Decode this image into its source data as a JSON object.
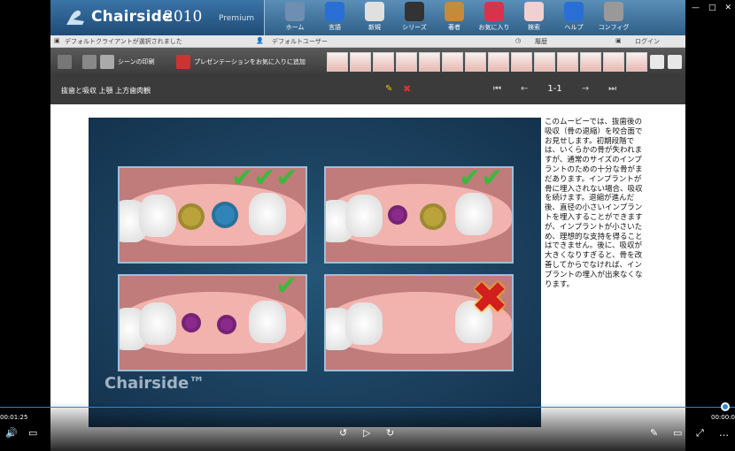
{
  "app": {
    "name": "Chairside",
    "year": "2010",
    "edition": "Premium"
  },
  "nav": [
    {
      "label": "ホーム",
      "icon": "chair-icon",
      "color": "#6f8fb0"
    },
    {
      "label": "言語",
      "icon": "language-icon",
      "color": "#2a6fd6"
    },
    {
      "label": "新規",
      "icon": "new-icon",
      "color": "#e0e0e0"
    },
    {
      "label": "シリーズ",
      "icon": "clapper-icon",
      "color": "#333333"
    },
    {
      "label": "著者",
      "icon": "author-icon",
      "color": "#c58a3a"
    },
    {
      "label": "お気に入り",
      "icon": "favorites-icon",
      "color": "#d8334c"
    },
    {
      "label": "検索",
      "icon": "search-teeth-icon",
      "color": "#f0d0d0"
    },
    {
      "label": "ヘルプ",
      "icon": "help-icon",
      "color": "#2a6fd6"
    },
    {
      "label": "コンフィグ",
      "icon": "config-icon",
      "color": "#999999"
    }
  ],
  "status": {
    "client": "デフォルトクライアントが選択されました",
    "user": "デフォルトユーザー",
    "history": "履歴",
    "login": "ログイン"
  },
  "toolbar": {
    "print_scene": "シーンの印刷",
    "add_favorite": "プレゼンテーションをお気に入りに追加"
  },
  "breadcrumb": "抜歯と吸収  上顎  上方歯肉観",
  "pager": {
    "page": "1-1"
  },
  "video_watermark": "Chairside™",
  "description": "このムービーでは、抜歯後の吸収（骨の退縮）を咬合面でお見せします。初期段階では、いくらかの骨が失われますが、通常のサイズのインプラントのための十分な骨がまだあります。インプラントが骨に埋入されない場合、吸収を続けます。退縮が進んだ後、直径の小さいインプラントを埋入することができますが、インプラントが小さいため、理想的な支持を得ることはできません。後に、吸収が大きくなりすぎると、骨を改善してからでなければ、インプラントの埋入が出来なくなります。",
  "player": {
    "elapsed": "00:01:25",
    "remaining": "00:00:0"
  }
}
